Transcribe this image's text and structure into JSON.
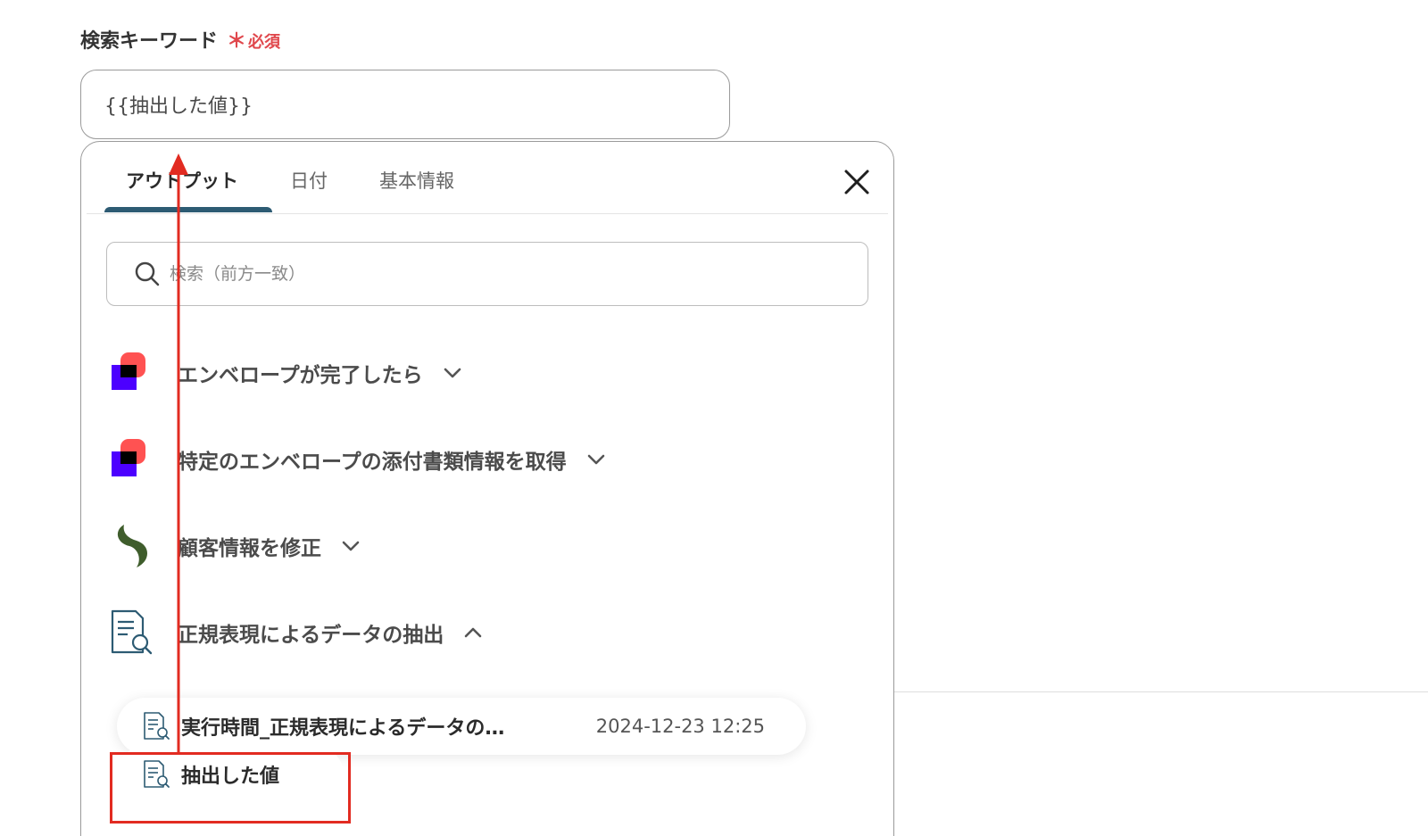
{
  "field": {
    "label": "検索キーワード",
    "required_star": "＊",
    "required_text": "必須",
    "value": "{{抽出した値}}"
  },
  "panel": {
    "tabs": [
      {
        "label": "アウトプット",
        "active": true
      },
      {
        "label": "日付",
        "active": false
      },
      {
        "label": "基本情報",
        "active": false
      }
    ],
    "close_icon": "close-icon",
    "search_placeholder": "検索（前方一致）",
    "sections": [
      {
        "label": "エンベロープが完了したら",
        "icon": "docusign-logo-icon",
        "expanded": false
      },
      {
        "label": "特定のエンベロープの添付書類情報を取得",
        "icon": "docusign-logo-icon",
        "expanded": false
      },
      {
        "label": "顧客情報を修正",
        "icon": "crescent-logo-icon",
        "expanded": false
      },
      {
        "label": "正規表現によるデータの抽出",
        "icon": "document-search-icon",
        "expanded": true
      }
    ],
    "outputs": [
      {
        "label": "実行時間_正規表現によるデータの…",
        "value": "2024-12-23 12:25"
      },
      {
        "label": "抽出した値",
        "value": ""
      }
    ]
  },
  "colors": {
    "accent_tab": "#2d5b73",
    "required": "#e0474c",
    "annotation": "#e22b21",
    "docusign_purple": "#4c00ff",
    "docusign_coral": "#ff5252",
    "crescent_green": "#3f5d2c"
  }
}
